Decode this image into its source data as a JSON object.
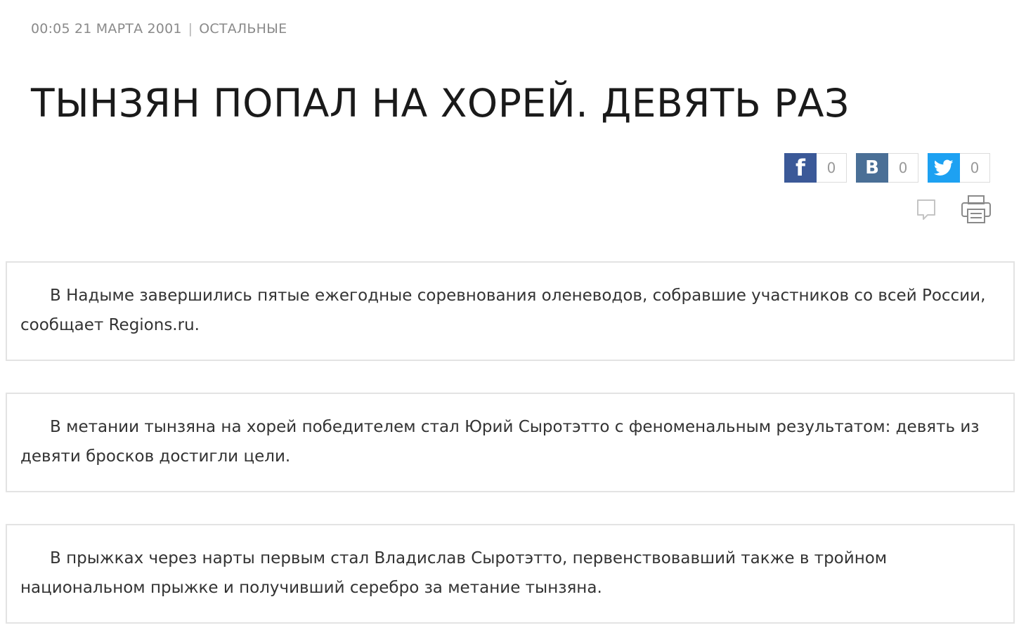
{
  "meta": {
    "datetime": "00:05 21 МАРТА 2001",
    "separator": "|",
    "category": "ОСТАЛЬНЫЕ"
  },
  "article": {
    "title": "ТЫНЗЯН ПОПАЛ НА ХОРЕЙ. ДЕВЯТЬ РАЗ",
    "paragraphs": [
      "В Надыме завершились пятые ежегодные соревнования оленеводов, собравшие участников со всей России, сообщает Regions.ru.",
      "В метании тынзяна на хорей победителем стал Юрий Сыротэтто с феноменальным результатом: девять из девяти бросков достигли цели.",
      "В прыжках через нарты первым стал Владислав Сыротэтто, первенствовавший также в тройном национальном прыжке и получивший серебро за метание тынзяна."
    ]
  },
  "share": {
    "facebook": {
      "icon": "facebook-icon",
      "letter": "f",
      "count": "0",
      "color": "#3b5998"
    },
    "vkontakte": {
      "icon": "vk-icon",
      "letter": "В",
      "count": "0",
      "color": "#4a6f96"
    },
    "twitter": {
      "icon": "twitter-icon",
      "count": "0",
      "color": "#1da1f2"
    }
  },
  "tools": {
    "comment_icon": "comment-icon",
    "print_icon": "print-icon"
  }
}
